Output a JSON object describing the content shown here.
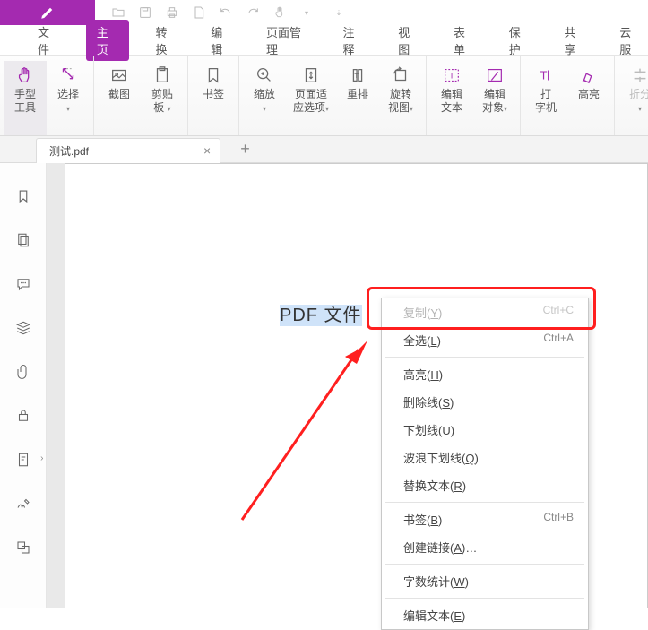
{
  "menubar": {
    "file": "文件",
    "home": "主页",
    "convert": "转换",
    "edit": "编辑",
    "page": "页面管理",
    "comment": "注释",
    "view": "视图",
    "form": "表单",
    "protect": "保护",
    "share": "共享",
    "cloud": "云服"
  },
  "ribbon": {
    "hand": "手型\n工具",
    "select": "选择",
    "select_dd": "▾",
    "snapshot": "截图",
    "clipboard": "剪贴\n板",
    "clipboard_dd": "▾",
    "bookmark": "书签",
    "zoom": "缩放",
    "zoom_dd": "▾",
    "fit": "页面适\n应选项",
    "fit_dd": "▾",
    "reflow": "重排",
    "rotate": "旋转\n视图",
    "rotate_dd": "▾",
    "edittext": "编辑\n文本",
    "editobj": "编辑\n对象",
    "editobj_dd": "▾",
    "typewriter": "打\n字机",
    "highlight": "高亮",
    "collapse": "折分",
    "collapse_dd": "▾"
  },
  "tab": {
    "name": "测试.pdf"
  },
  "selected_text": "PDF 文件",
  "context_menu": {
    "copy": "复制",
    "copy_k": "Y",
    "copy_sc": "Ctrl+C",
    "selectall": "全选",
    "selectall_k": "L",
    "selectall_sc": "Ctrl+A",
    "highlight": "高亮",
    "highlight_k": "H",
    "strike": "删除线",
    "strike_k": "S",
    "underline": "下划线",
    "underline_k": "U",
    "squiggly": "波浪下划线",
    "squiggly_k": "Q",
    "replace": "替换文本",
    "replace_k": "R",
    "bookmark": "书签",
    "bookmark_k": "B",
    "bookmark_sc": "Ctrl+B",
    "link": "创建链接",
    "link_k": "A",
    "link_suffix": "…",
    "wordcount": "字数统计",
    "wordcount_k": "W",
    "edittext": "编辑文本",
    "edittext_k": "E"
  }
}
